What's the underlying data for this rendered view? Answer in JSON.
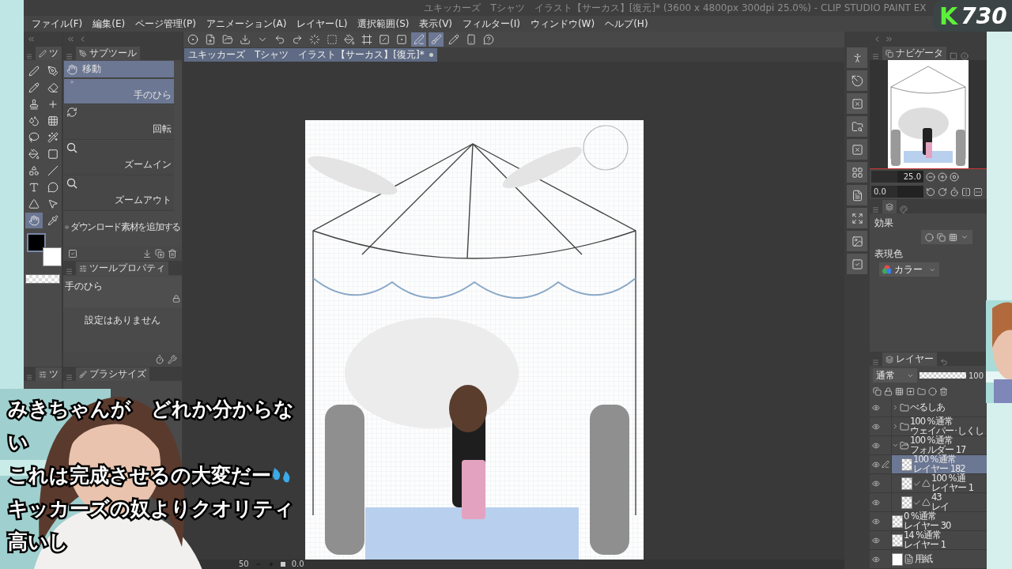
{
  "title_bar": {
    "title": "ユキッカーズ　Tシャツ　イラスト【サーカス】[復元]* (3600 x 4800px 300dpi 25.0%)  - CLIP STUDIO PAINT EX"
  },
  "menu": [
    "ファイル(F)",
    "編集(E)",
    "ページ管理(P)",
    "アニメーション(A)",
    "レイヤー(L)",
    "選択範囲(S)",
    "表示(V)",
    "フィルター(I)",
    "ウィンドウ(W)",
    "ヘルプ(H)"
  ],
  "tool_palette": {
    "tab": "ツ",
    "tools": [
      {
        "selected": false
      },
      {
        "selected": false
      },
      {
        "selected": false
      },
      {
        "selected": false
      },
      {
        "selected": false
      },
      {
        "selected": false
      },
      {
        "selected": false
      },
      {
        "selected": false
      },
      {
        "selected": false
      },
      {
        "selected": false
      },
      {
        "selected": false
      },
      {
        "selected": false
      },
      {
        "selected": false
      },
      {
        "selected": false
      },
      {
        "selected": false
      },
      {
        "selected": false
      },
      {
        "selected": false
      },
      {
        "selected": false
      },
      {
        "selected": true
      },
      {
        "selected": false
      }
    ]
  },
  "subtool": {
    "tab": "サブツール",
    "items": [
      {
        "label": "移動",
        "selected": true,
        "kind": "group"
      },
      {
        "label": "手のひら",
        "selected": true,
        "kind": "tool"
      },
      {
        "label": "回転",
        "selected": false,
        "kind": "tool"
      },
      {
        "label": "ズームイン",
        "selected": false,
        "kind": "tool"
      },
      {
        "label": "ズームアウト",
        "selected": false,
        "kind": "tool"
      }
    ],
    "add_material": "ダウンロード素材を追加する"
  },
  "tool_property": {
    "tab": "ツールプロパティ",
    "tool_name": "手のひら",
    "message": "設定はありません"
  },
  "bottom_tabs": [
    "ツ",
    "ブラシサイズ"
  ],
  "toolbar": [
    {
      "active": false
    },
    {
      "active": false
    },
    {
      "active": false
    },
    {
      "active": false
    },
    {
      "active": false
    },
    {
      "active": false
    },
    {
      "active": false
    },
    {
      "active": false
    },
    {
      "active": false
    },
    {
      "active": false
    },
    {
      "active": false
    },
    {
      "active": false
    },
    {
      "active": false
    },
    {
      "active": true
    },
    {
      "active": true
    },
    {
      "active": false
    },
    {
      "active": false
    },
    {
      "active": false
    }
  ],
  "document_tab": {
    "title": "ユキッカーズ　Tシャツ　イラスト【サーカス】[復元]*"
  },
  "status_bar": {
    "zoom": "50",
    "angle": "0.0"
  },
  "navigator": {
    "tab": "ナビゲータ",
    "zoom": "25.0",
    "angle": "0.0"
  },
  "layer_property": {
    "effect_label": "効果",
    "color_label": "表現色",
    "color_mode": "カラー"
  },
  "layers": {
    "tab": "レイヤー",
    "blend_mode": "通常",
    "opacity": "100",
    "rows": [
      {
        "kind": "folder",
        "name": "べるしあ",
        "expanded": false,
        "selected": false
      },
      {
        "kind": "folder",
        "mode": "100 %通常",
        "name": "ウェイパー･しくし",
        "expanded": false,
        "selected": false
      },
      {
        "kind": "folder",
        "mode": "100 %通常",
        "name": "フォルダー 17",
        "expanded": true,
        "selected": false,
        "children": [
          {
            "kind": "layer",
            "mode": "100 %通常",
            "name": "レイヤー 182",
            "selected": true
          },
          {
            "kind": "clipped",
            "mode": "100 %通",
            "name": "レイヤー 1",
            "selected": false
          },
          {
            "kind": "clipped",
            "mode": "43",
            "name": "レイ",
            "selected": false
          }
        ]
      },
      {
        "kind": "layer",
        "mode": "0 %通常",
        "name": "レイヤー 30",
        "selected": false
      },
      {
        "kind": "layer",
        "mode": "14 %通常",
        "name": "レイヤー 1",
        "selected": false
      },
      {
        "kind": "paper",
        "name": "用紙",
        "selected": false
      }
    ]
  },
  "captions": [
    "みきちゃんが　どれか分からな",
    "い",
    "これは完成させるの大変だー",
    "キッカーズの奴よりクオリティ",
    "高いし"
  ],
  "badge": {
    "letter": "K",
    "count": "730"
  }
}
